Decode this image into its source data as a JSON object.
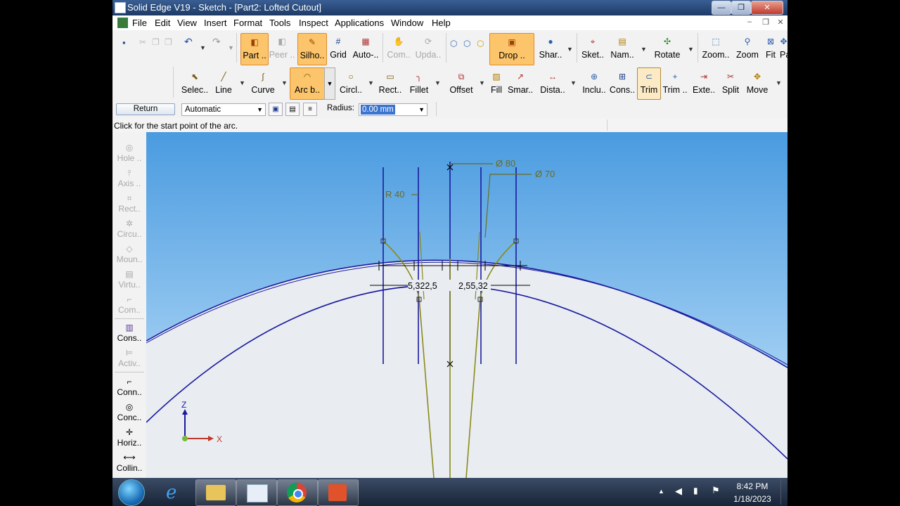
{
  "window": {
    "title": "Solid Edge V19 - Sketch - [Part2: Lofted Cutout]",
    "minimize": "—",
    "maximize": "❐",
    "close": "✕"
  },
  "menubar": {
    "items": [
      "File",
      "Edit",
      "View",
      "Insert",
      "Format",
      "Tools",
      "Inspect",
      "Applications",
      "Window",
      "Help"
    ],
    "mdi_minimize": "–",
    "mdi_restore": "❐",
    "mdi_close": "✕"
  },
  "ribbon1": {
    "part": "Part ..",
    "peer": "Peer ..",
    "silho": "Silho..",
    "grid": "Grid",
    "auto": "Auto-..",
    "com": "Com..",
    "upda": "Upda..",
    "drop": "Drop ..",
    "shar": "Shar..",
    "sket": "Sket..",
    "nam": "Nam..",
    "rotate": "Rotate",
    "zoom_area": "Zoom..",
    "zoom": "Zoom",
    "fit": "Fit",
    "pa": "Pa"
  },
  "ribbon2": {
    "select": "Selec..",
    "line": "Line",
    "curve": "Curve",
    "arc": "Arc b..",
    "circle": "Circl..",
    "rect": "Rect..",
    "fillet": "Fillet",
    "offset": "Offset",
    "fill": "Fill",
    "smart": "Smar..",
    "distance": "Dista..",
    "include": "Inclu..",
    "constraints": "Cons..",
    "trim": "Trim",
    "trim_ext": "Trim ..",
    "extend": "Exte..",
    "split": "Split",
    "move": "Move"
  },
  "command_bar": {
    "return_label": "Return",
    "mode_value": "Automatic",
    "radius_label": "Radius:",
    "radius_value": "0.00 mm"
  },
  "status": {
    "prompt": "Click for the start point of the arc."
  },
  "sidebar": {
    "hole": "Hole ..",
    "axis": "Axis ..",
    "rect": "Rect..",
    "circu": "Circu..",
    "moun": "Moun..",
    "virtu": "Virtu..",
    "com": "Com..",
    "cons": "Cons..",
    "activ": "Activ..",
    "conn": "Conn..",
    "conc": "Conc..",
    "horiz": "Horiz..",
    "collin": "Collin.."
  },
  "sketch": {
    "dim_d80": "Ø 80",
    "dim_d70": "Ø 70",
    "dim_r40": "R 40",
    "dim_left": "5,322,5",
    "dim_right": "2,55,32",
    "axis_z": "Z",
    "axis_x": "X",
    "colors": {
      "sky_top": "#4a9be0",
      "sky_bottom": "#c8e6fb",
      "body": "#e9edf1",
      "geometry": "#1a1a9e",
      "dimension": "#6b6b1e"
    }
  },
  "taskbar": {
    "time": "8:42 PM",
    "date": "1/18/2023",
    "apps": [
      "start-orb",
      "internet-explorer",
      "file-explorer",
      "solid-edge",
      "chrome",
      "office"
    ]
  }
}
